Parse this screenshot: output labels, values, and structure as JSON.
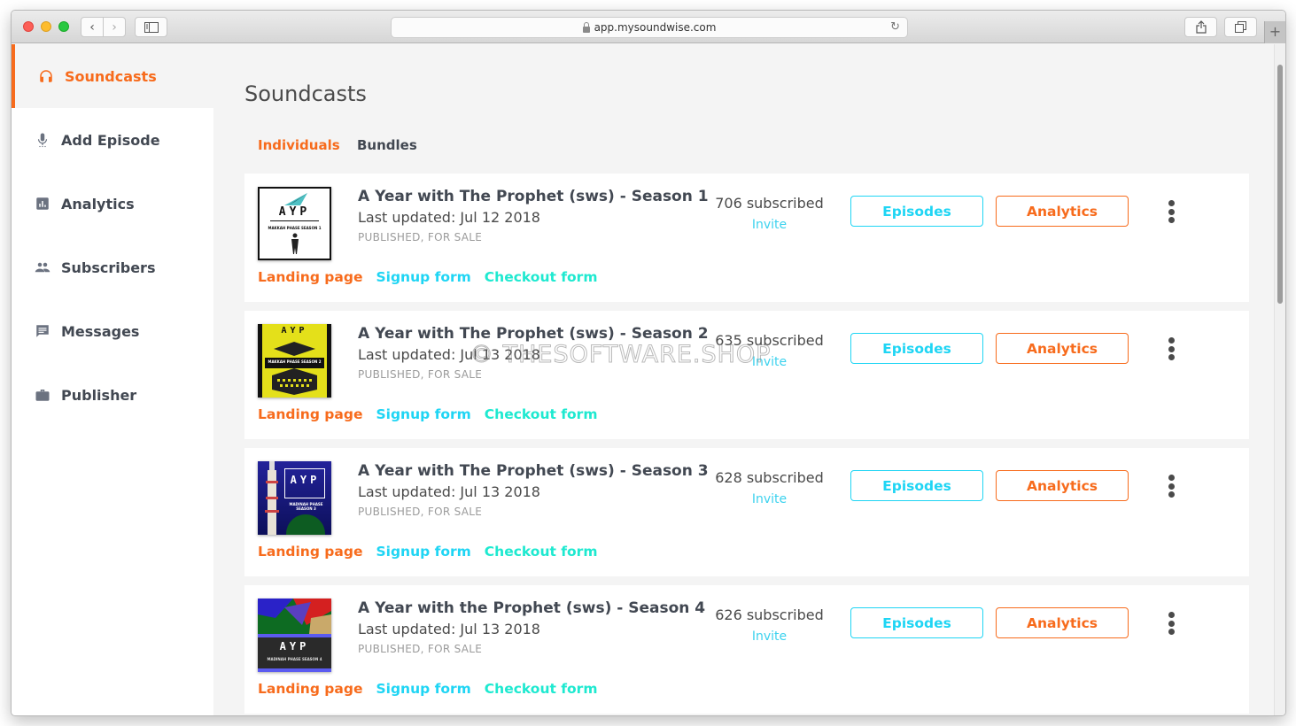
{
  "browser": {
    "url": "app.mysoundwise.com",
    "icons": {
      "back": "chevron-left-icon",
      "forward": "chevron-right-icon",
      "sidebar": "sidebar-toggle-icon",
      "lock": "lock-icon",
      "reload": "reload-icon",
      "share": "share-icon",
      "tabs": "tabs-overview-icon",
      "new_tab": "plus-icon"
    },
    "glyphs": {
      "back": "‹",
      "forward": "›",
      "reload": "↻",
      "new_tab": "+"
    }
  },
  "sidebar": {
    "items": [
      {
        "label": "Soundcasts",
        "icon": "headphones-icon",
        "active": true
      },
      {
        "label": "Add Episode",
        "icon": "microphone-icon",
        "active": false
      },
      {
        "label": "Analytics",
        "icon": "bar-chart-icon",
        "active": false
      },
      {
        "label": "Subscribers",
        "icon": "people-icon",
        "active": false
      },
      {
        "label": "Messages",
        "icon": "message-icon",
        "active": false
      },
      {
        "label": "Publisher",
        "icon": "briefcase-icon",
        "active": false
      }
    ]
  },
  "main": {
    "title": "Soundcasts",
    "tabs": [
      {
        "label": "Individuals",
        "active": true
      },
      {
        "label": "Bundles",
        "active": false
      }
    ],
    "soundcasts": [
      {
        "title": "A Year with The Prophet (sws) - Season 1",
        "last_updated": "Last updated: Jul 12 2018",
        "status": "PUBLISHED, FOR SALE",
        "subscribed": "706 subscribed",
        "invite": "Invite",
        "episodes_label": "Episodes",
        "analytics_label": "Analytics",
        "links": {
          "landing": "Landing page",
          "signup": "Signup form",
          "checkout": "Checkout form"
        },
        "cover": {
          "text": "AYP",
          "subtitle": "MAKKAH PHASE SEASON 1",
          "bg": "#ffffff",
          "fg": "#111111"
        }
      },
      {
        "title": "A Year with The Prophet (sws) - Season 2",
        "last_updated": "Last updated: Jul 13 2018",
        "status": "PUBLISHED, FOR SALE",
        "subscribed": "635 subscribed",
        "invite": "Invite",
        "episodes_label": "Episodes",
        "analytics_label": "Analytics",
        "links": {
          "landing": "Landing page",
          "signup": "Signup form",
          "checkout": "Checkout form"
        },
        "cover": {
          "text": "AYP",
          "subtitle": "MAKKAH PHASE SEASON 2",
          "bg": "#e4e01a",
          "fg": "#111111"
        }
      },
      {
        "title": "A Year with The Prophet (sws) - Season 3",
        "last_updated": "Last updated: Jul 13 2018",
        "status": "PUBLISHED, FOR SALE",
        "subscribed": "628 subscribed",
        "invite": "Invite",
        "episodes_label": "Episodes",
        "analytics_label": "Analytics",
        "links": {
          "landing": "Landing page",
          "signup": "Signup form",
          "checkout": "Checkout form"
        },
        "cover": {
          "text": "AYP",
          "subtitle": "MADINAH PHASE SEASON 3",
          "bg": "#1d1f8a",
          "fg": "#ffffff"
        }
      },
      {
        "title": "A Year with the Prophet (sws) - Season 4",
        "last_updated": "Last updated: Jul 13 2018",
        "status": "PUBLISHED, FOR SALE",
        "subscribed": "626 subscribed",
        "invite": "Invite",
        "episodes_label": "Episodes",
        "analytics_label": "Analytics",
        "links": {
          "landing": "Landing page",
          "signup": "Signup form",
          "checkout": "Checkout form"
        },
        "cover": {
          "text": "AYP",
          "subtitle": "MADINAH PHASE SEASON 4",
          "bg": "#2a2a2a",
          "fg": "#ffffff"
        }
      }
    ]
  },
  "watermark": "© THESOFTWARE.SHOP",
  "colors": {
    "accent_orange": "#f76b1c",
    "accent_cyan": "#1fd5f4",
    "accent_teal": "#1ee9d0",
    "text_dark": "#424852"
  }
}
